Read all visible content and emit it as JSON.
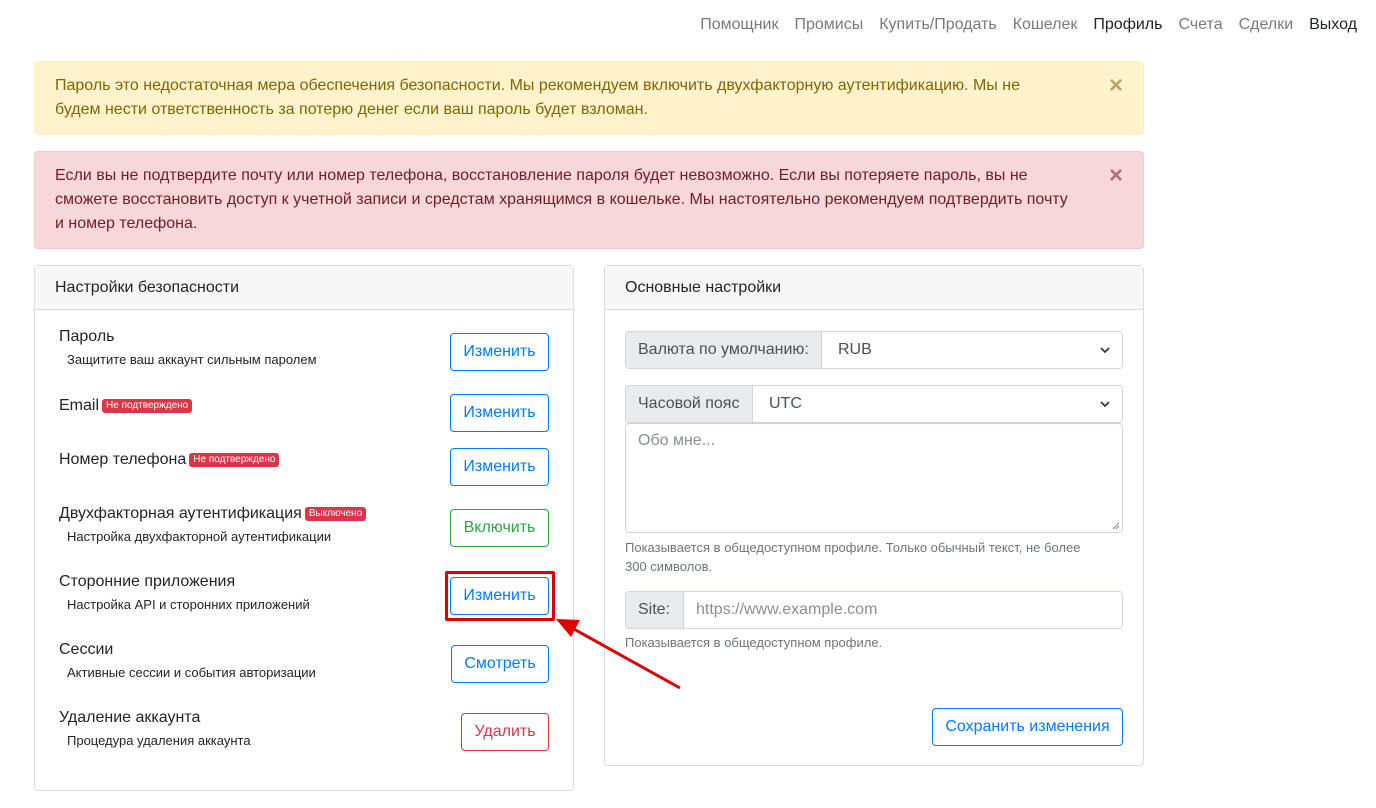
{
  "nav": {
    "items": [
      "Помощник",
      "Промисы",
      "Купить/Продать",
      "Кошелек",
      "Профиль",
      "Счета",
      "Сделки",
      "Выход"
    ]
  },
  "alerts": {
    "warning": "Пароль это недостаточная мера обеспечения безопасности. Мы рекомендуем включить двухфакторную аутентификацию. Мы не будем нести ответственность за потерю денег если ваш пароль будет взломан.",
    "danger": "Если вы не подтвердите почту или номер телефона, восстановление пароля будет невозможно. Если вы потеряете пароль, вы не сможете восстановить доступ к учетной записи и средстам хранящимся в кошельке. Мы настоятельно рекомендуем подтвердить почту и номер телефона.",
    "close_symbol": "×"
  },
  "security": {
    "title": "Настройки безопасности",
    "items": [
      {
        "title": "Пароль",
        "desc": "Защитите ваш аккаунт сильным паролем",
        "badge": "",
        "button": "Изменить"
      },
      {
        "title": "Email",
        "desc": "",
        "badge": "Не подтверждено",
        "button": "Изменить"
      },
      {
        "title": "Номер телефона",
        "desc": "",
        "badge": "Не подтверждено",
        "button": "Изменить"
      },
      {
        "title": "Двухфакторная аутентификация",
        "desc": "Настройка двухфакторной аутентификации",
        "badge": "Выключено",
        "button": "Включить"
      },
      {
        "title": "Сторонние приложения",
        "desc": "Настройка API и сторонних приложений",
        "badge": "",
        "button": "Изменить"
      },
      {
        "title": "Сессии",
        "desc": "Активные сессии и события авторизации",
        "badge": "",
        "button": "Смотреть"
      },
      {
        "title": "Удаление аккаунта",
        "desc": "Процедура удаления аккаунта",
        "badge": "",
        "button": "Удалить"
      }
    ]
  },
  "general": {
    "title": "Основные настройки",
    "currency_label": "Валюта по умолчанию:",
    "currency_value": "RUB",
    "timezone_label": "Часовой пояс",
    "timezone_value": "UTC",
    "about_placeholder": "Обо мне...",
    "about_help": "Показывается в общедоступном профиле. Только обычный текст, не более 300 символов.",
    "site_label": "Site:",
    "site_placeholder": "https://www.example.com",
    "site_help": "Показывается в общедоступном профиле.",
    "save_button": "Сохранить изменения"
  },
  "colors": {
    "primary": "#007bff",
    "success": "#28a745",
    "danger": "#dc3545",
    "highlight": "#e00000"
  }
}
